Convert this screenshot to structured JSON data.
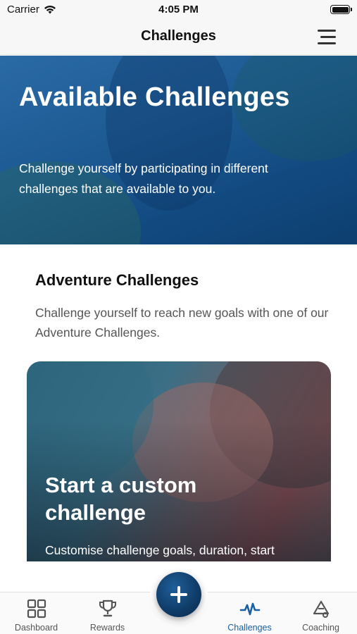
{
  "status_bar": {
    "carrier": "Carrier",
    "time": "4:05 PM",
    "wifi_icon": "wifi-icon",
    "battery_icon": "battery-icon"
  },
  "nav": {
    "title": "Challenges",
    "menu_icon": "hamburger-menu-icon"
  },
  "hero": {
    "title": "Available Challenges",
    "description": "Challenge yourself by participating in different challenges that are available to you."
  },
  "section": {
    "title": "Adventure Challenges",
    "description": "Challenge yourself to reach new goals with one of our Adventure Challenges."
  },
  "card": {
    "title": "Start a custom challenge",
    "description": "Customise challenge goals, duration, start"
  },
  "tab_bar": {
    "fab_icon": "plus-icon",
    "tabs": [
      {
        "label": "Dashboard",
        "icon": "grid-icon"
      },
      {
        "label": "Rewards",
        "icon": "trophy-icon"
      },
      {
        "label": "Challenges",
        "icon": "activity-pulse-icon",
        "active": true
      },
      {
        "label": "Coaching",
        "icon": "coaching-icon"
      }
    ]
  },
  "colors": {
    "accent": "#1a5ea3",
    "fab": "#0f3b66",
    "hero": "#1d5a94"
  }
}
